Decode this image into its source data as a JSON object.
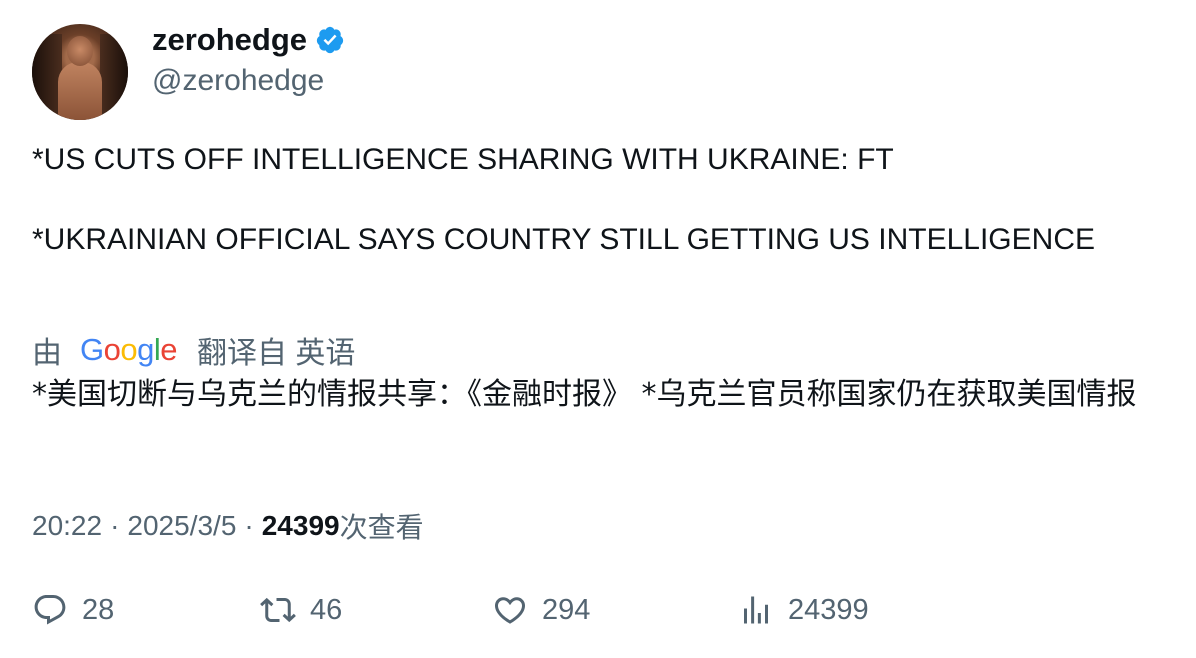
{
  "user": {
    "display_name": "zerohedge",
    "handle": "@zerohedge",
    "verified_color": "#1d9bf0"
  },
  "tweet": {
    "lines": [
      "*US CUTS OFF INTELLIGENCE SHARING WITH UKRAINE: FT",
      "*UKRAINIAN OFFICIAL SAYS COUNTRY STILL GETTING US INTELLIGENCE"
    ]
  },
  "translation": {
    "by": "由",
    "provider": "Google",
    "suffix": "翻译自 英语",
    "text": "*美国切断与乌克兰的情报共享：《金融时报》 *乌克兰官员称国家仍在获取美国情报"
  },
  "meta": {
    "time": "20:22",
    "separator": "·",
    "date": "2025/3/5",
    "views": "24399",
    "views_label": "次查看"
  },
  "actions": {
    "replies": "28",
    "retweets": "46",
    "likes": "294",
    "views": "24399"
  },
  "icons": {
    "verified": "verified-badge-icon",
    "reply": "reply-icon",
    "retweet": "retweet-icon",
    "like": "heart-icon",
    "views": "analytics-icon"
  }
}
